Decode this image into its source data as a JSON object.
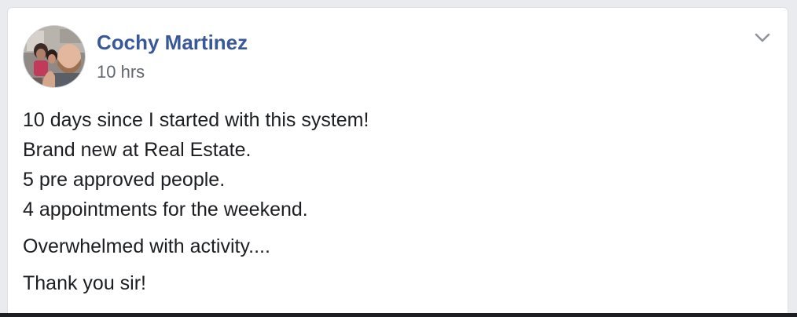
{
  "post": {
    "author": {
      "name": "Cochy Martinez",
      "avatar_icon": "profile-photo"
    },
    "timestamp": "10 hrs",
    "menu_icon": "chevron-down-icon",
    "paragraphs": [
      {
        "lines": [
          "10 days since I started with this system!",
          "Brand new at Real Estate.",
          "5 pre approved people.",
          "4 appointments for the weekend."
        ]
      },
      {
        "lines": [
          "Overwhelmed with activity...."
        ]
      },
      {
        "lines": [
          "Thank you sir!"
        ]
      }
    ]
  },
  "colors": {
    "page_background": "#e9ebee",
    "card_background": "#ffffff",
    "name_link": "#385898",
    "timestamp": "#616770",
    "body_text": "#1c1e21",
    "chevron": "#90949c"
  }
}
